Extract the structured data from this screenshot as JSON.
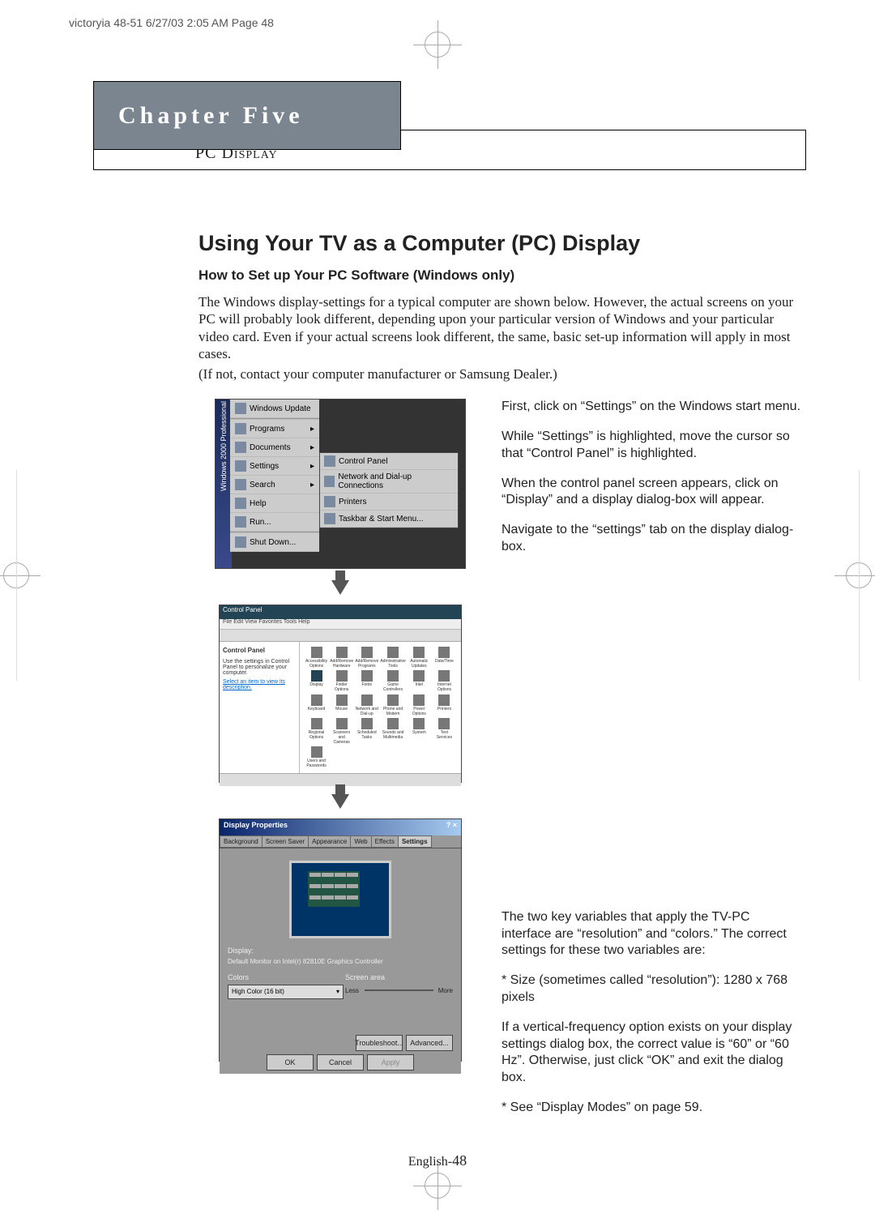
{
  "slug": "victoryia 48-51  6/27/03 2:05 AM  Page 48",
  "chapter": {
    "title": "Chapter Five",
    "subtitle": "PC Display"
  },
  "main": {
    "heading": "Using Your TV as a Computer (PC) Display",
    "subheading": "How to Set up Your PC Software (Windows only)",
    "body1": "The Windows display-settings for a typical computer are shown below. However, the actual screens on your PC will probably look different, depending upon your particular version of Windows and your particular video card. Even if your actual screens look different, the same, basic set-up information will apply in most cases.",
    "body2": "(If not, contact your computer manufacturer or Samsung Dealer.)"
  },
  "right": {
    "p1": "First, click on “Settings” on the Windows start menu.",
    "p2": "While “Settings” is highlighted, move the cursor so that “Control Panel” is highlighted.",
    "p3": "When the control panel screen appears, click on “Display” and a display dialog-box will appear.",
    "p4": "Navigate to the “settings” tab on the display dialog-box.",
    "p5": "The two key variables that apply the TV-PC interface are “resolution” and “colors.” The correct settings for these two variables are:",
    "p6": "* Size (sometimes called “resolution”): 1280 x 768 pixels",
    "p7": "If a vertical-frequency option exists on your display settings dialog box, the correct value is “60” or “60 Hz”. Otherwise, just click “OK” and exit the dialog box.",
    "p8": "* See “Display Modes” on page 59."
  },
  "startmenu": {
    "sidebar": "Windows 2000 Professional",
    "items": [
      "Windows Update",
      "Programs",
      "Documents",
      "Settings",
      "Search",
      "Help",
      "Run...",
      "Shut Down..."
    ],
    "submenu": [
      "Control Panel",
      "Network and Dial-up Connections",
      "Printers",
      "Taskbar & Start Menu..."
    ]
  },
  "controlpanel": {
    "title": "Control Panel",
    "menubar": "File  Edit  View  Favorites  Tools  Help",
    "side_title": "Control Panel",
    "side_text": "Use the settings in Control Panel to personalize your computer.",
    "side_link": "Select an item to view its description.",
    "icons": [
      "Accessibility Options",
      "Add/Remove Hardware",
      "Add/Remove Programs",
      "Administrative Tools",
      "Automatic Updates",
      "Date/Time",
      "Display",
      "Folder Options",
      "Fonts",
      "Game Controllers",
      "Intel",
      "Internet Options",
      "Keyboard",
      "Mouse",
      "Network and Dial-up",
      "Phone and Modem",
      "Power Options",
      "Printers",
      "Regional Options",
      "Scanners and Cameras",
      "Scheduled Tasks",
      "Sounds and Multimedia",
      "System",
      "Text Services",
      "Users and Passwords"
    ]
  },
  "displayprops": {
    "title": "Display Properties",
    "close": "? ×",
    "tabs": [
      "Background",
      "Screen Saver",
      "Appearance",
      "Web",
      "Effects",
      "Settings"
    ],
    "display_label": "Display:",
    "display_value": "Default Monitor on Intel(r) 82810E Graphics Controller",
    "colors_label": "Colors",
    "colors_value": "High Color (16 bit)",
    "area_label": "Screen area",
    "area_less": "Less",
    "area_more": "More",
    "advanced": "Advanced...",
    "troubleshoot": "Troubleshoot...",
    "ok": "OK",
    "cancel": "Cancel",
    "apply": "Apply"
  },
  "footer": {
    "lang": "English-",
    "page": "48"
  }
}
